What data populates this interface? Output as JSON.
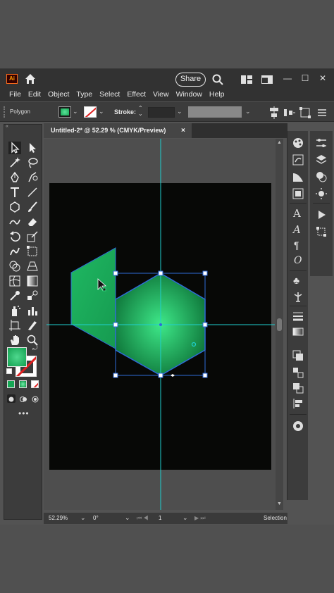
{
  "app": {
    "logo_text": "Ai",
    "share_label": "Share"
  },
  "menu": [
    "File",
    "Edit",
    "Object",
    "Type",
    "Select",
    "Effect",
    "View",
    "Window",
    "Help"
  ],
  "controlbar": {
    "object_type": "Polygon",
    "stroke_label": "Stroke:"
  },
  "document": {
    "tab_title": "Untitled-2* @ 52.29 % (CMYK/Preview)",
    "close_glyph": "×"
  },
  "statusbar": {
    "zoom": "52.29%",
    "rotation": "0°",
    "artboard_number": "1",
    "current_tool": "Selection"
  },
  "colors": {
    "fill_green": "#16a855",
    "guide_cyan": "#1fd0d0",
    "selection_blue": "#2f6bd8",
    "artboard": "#070806"
  },
  "icons": {
    "left_toolbar": [
      "selection-tool-icon",
      "direct-selection-tool-icon",
      "magic-wand-icon",
      "lasso-icon",
      "pen-tool-icon",
      "curvature-tool-icon",
      "type-tool-icon",
      "line-tool-icon",
      "polygon-tool-icon",
      "paintbrush-icon",
      "shaper-tool-icon",
      "eraser-icon",
      "rotate-tool-icon",
      "scale-tool-icon",
      "warp-tool-icon",
      "free-transform-icon",
      "shape-builder-icon",
      "perspective-grid-icon",
      "mesh-tool-icon",
      "gradient-tool-icon",
      "eyedropper-icon",
      "blend-tool-icon",
      "symbol-sprayer-icon",
      "graph-tool-icon",
      "artboard-tool-icon",
      "slice-tool-icon",
      "hand-tool-icon",
      "zoom-tool-icon"
    ],
    "right_dock": [
      "color-panel-icon",
      "brushes-panel-icon",
      "symbols-panel-icon",
      "graphic-styles-icon",
      "character-panel-icon",
      "paragraph-panel-icon",
      "opentype-panel-icon",
      "glyphs-panel-icon",
      "libraries-icon",
      "puppet-warp-icon",
      "stroke-panel-icon",
      "gradient-panel-icon",
      "transparency-panel-icon",
      "align-panel-icon",
      "pathfinder-icon",
      "transform-panel-icon",
      "navigator-icon"
    ]
  }
}
